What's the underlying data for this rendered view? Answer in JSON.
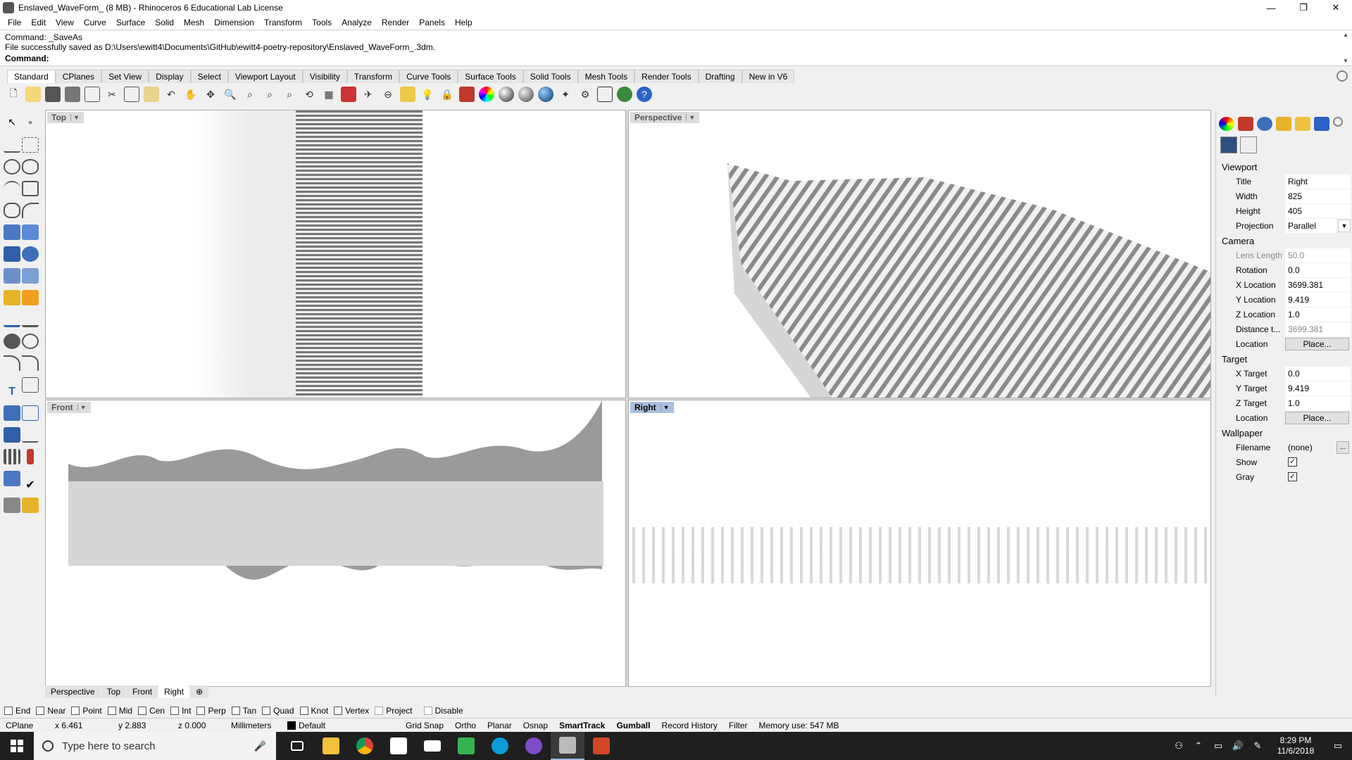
{
  "window": {
    "title": "Enslaved_WaveForm_ (8 MB) - Rhinoceros 6 Educational Lab License",
    "minimize": "—",
    "restore": "❐",
    "close": "✕"
  },
  "menu": [
    "File",
    "Edit",
    "View",
    "Curve",
    "Surface",
    "Solid",
    "Mesh",
    "Dimension",
    "Transform",
    "Tools",
    "Analyze",
    "Render",
    "Panels",
    "Help"
  ],
  "command": {
    "history_1": "Command: _SaveAs",
    "history_2": "File successfully saved as D:\\Users\\ewitt4\\Documents\\GitHub\\ewitt4-poetry-repository\\Enslaved_WaveForm_.3dm.",
    "prompt": "Command:"
  },
  "toolbar_tabs": [
    "Standard",
    "CPlanes",
    "Set View",
    "Display",
    "Select",
    "Viewport Layout",
    "Visibility",
    "Transform",
    "Curve Tools",
    "Surface Tools",
    "Solid Tools",
    "Mesh Tools",
    "Render Tools",
    "Drafting",
    "New in V6"
  ],
  "viewports": {
    "top": "Top",
    "perspective": "Perspective",
    "front": "Front",
    "right": "Right"
  },
  "viewport_tabs": [
    "Perspective",
    "Top",
    "Front",
    "Right"
  ],
  "osnaps": [
    "End",
    "Near",
    "Point",
    "Mid",
    "Cen",
    "Int",
    "Perp",
    "Tan",
    "Quad",
    "Knot",
    "Vertex",
    "Project"
  ],
  "osnap_disable": "Disable",
  "status": {
    "cplane": "CPlane",
    "x": "x 6.461",
    "y": "y 2.883",
    "z": "z 0.000",
    "units": "Millimeters",
    "layer": "Default",
    "grid_snap": "Grid Snap",
    "ortho": "Ortho",
    "planar": "Planar",
    "osnap": "Osnap",
    "smarttrack": "SmartTrack",
    "gumball": "Gumball",
    "record_history": "Record History",
    "filter": "Filter",
    "memory": "Memory use: 547 MB"
  },
  "properties": {
    "viewport_header": "Viewport",
    "title_label": "Title",
    "title_value": "Right",
    "width_label": "Width",
    "width_value": "825",
    "height_label": "Height",
    "height_value": "405",
    "projection_label": "Projection",
    "projection_value": "Parallel",
    "camera_header": "Camera",
    "lens_label": "Lens Length",
    "lens_value": "50.0",
    "rotation_label": "Rotation",
    "rotation_value": "0.0",
    "xloc_label": "X Location",
    "xloc_value": "3699.381",
    "yloc_label": "Y Location",
    "yloc_value": "9.419",
    "zloc_label": "Z Location",
    "zloc_value": "1.0",
    "dist_label": "Distance t...",
    "dist_value": "3699.381",
    "location_label": "Location",
    "place_button": "Place...",
    "target_header": "Target",
    "xt_label": "X Target",
    "xt_value": "0.0",
    "yt_label": "Y Target",
    "yt_value": "9.419",
    "zt_label": "Z Target",
    "zt_value": "1.0",
    "tloc_label": "Location",
    "tplace_button": "Place...",
    "wallpaper_header": "Wallpaper",
    "filename_label": "Filename",
    "filename_value": "(none)",
    "show_label": "Show",
    "gray_label": "Gray"
  },
  "taskbar": {
    "search_placeholder": "Type here to search",
    "time": "8:29 PM",
    "date": "11/6/2018"
  },
  "colors": {
    "active_viewport": "#a9c0df",
    "taskbar": "#1f1f1f"
  }
}
